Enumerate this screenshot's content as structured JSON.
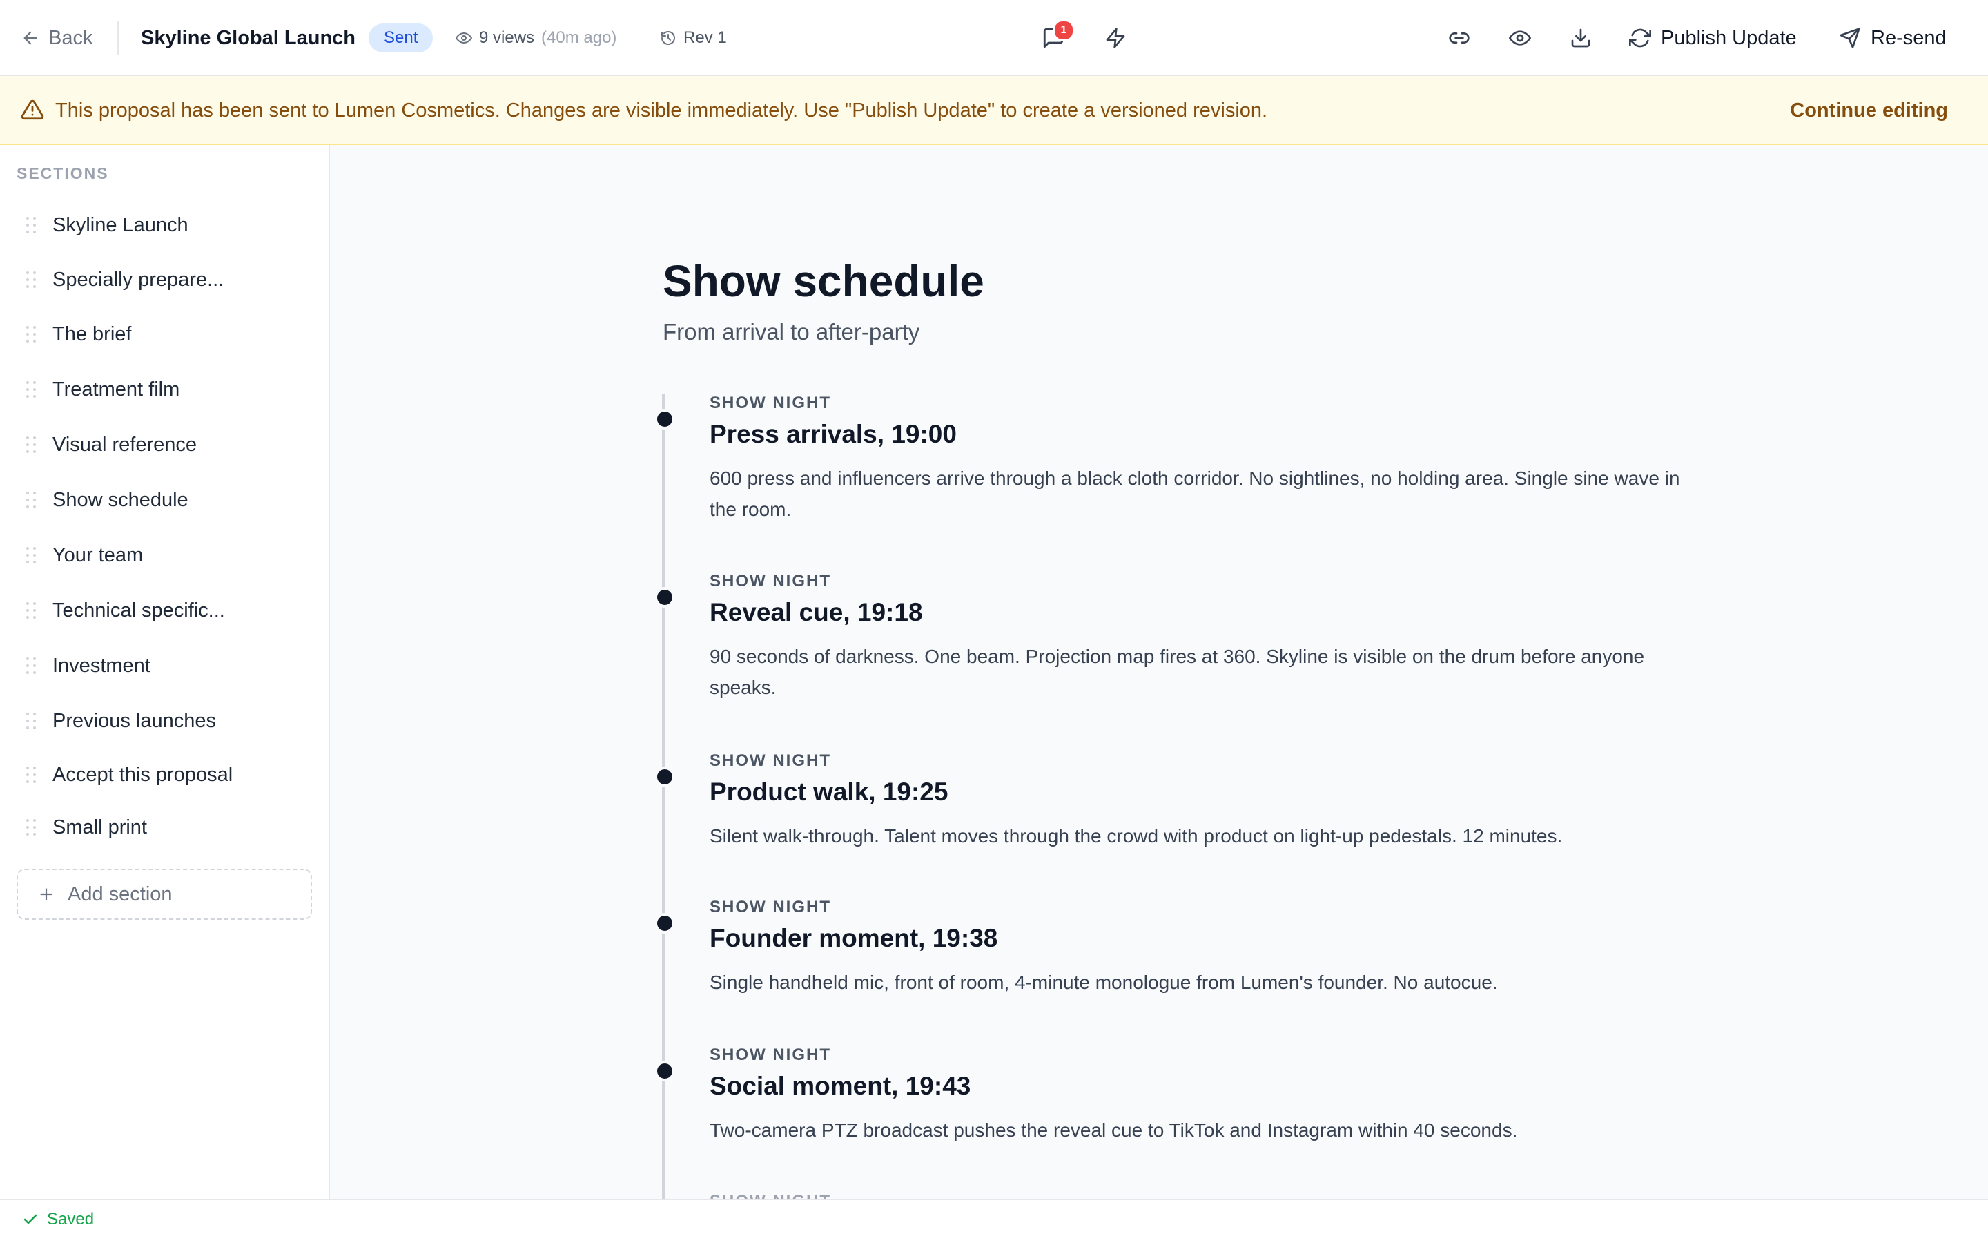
{
  "header": {
    "back_label": "Back",
    "title": "Skyline Global Launch",
    "status_badge": "Sent",
    "views_count": "9 views",
    "views_time": "(40m ago)",
    "revision": "Rev 1",
    "notification_count": "1",
    "publish_label": "Publish Update",
    "resend_label": "Re-send"
  },
  "banner": {
    "message": "This proposal has been sent to Lumen Cosmetics. Changes are visible immediately. Use \"Publish Update\" to create a versioned revision.",
    "action_label": "Continue editing"
  },
  "sidebar": {
    "heading": "SECTIONS",
    "items": [
      {
        "label": "Skyline Launch"
      },
      {
        "label": "Specially prepare..."
      },
      {
        "label": "The brief"
      },
      {
        "label": "Treatment film"
      },
      {
        "label": "Visual reference"
      },
      {
        "label": "Show schedule"
      },
      {
        "label": "Your team"
      },
      {
        "label": "Technical specific..."
      },
      {
        "label": "Investment"
      },
      {
        "label": "Previous launches"
      },
      {
        "label": "Accept this proposal"
      },
      {
        "label": "Small print"
      }
    ],
    "add_label": "Add section"
  },
  "main": {
    "title": "Show schedule",
    "subtitle": "From arrival to after-party",
    "events": [
      {
        "kicker": "SHOW NIGHT",
        "title": "Press arrivals, 19:00",
        "description": "600 press and influencers arrive through a black cloth corridor. No sightlines, no holding area. Single sine wave in the room."
      },
      {
        "kicker": "SHOW NIGHT",
        "title": "Reveal cue, 19:18",
        "description": "90 seconds of darkness. One beam. Projection map fires at 360. Skyline is visible on the drum before anyone speaks."
      },
      {
        "kicker": "SHOW NIGHT",
        "title": "Product walk, 19:25",
        "description": "Silent walk-through. Talent moves through the crowd with product on light-up pedestals. 12 minutes."
      },
      {
        "kicker": "SHOW NIGHT",
        "title": "Founder moment, 19:38",
        "description": "Single handheld mic, front of room, 4-minute monologue from Lumen's founder. No autocue."
      },
      {
        "kicker": "SHOW NIGHT",
        "title": "Social moment, 19:43",
        "description": "Two-camera PTZ broadcast pushes the reveal cue to TikTok and Instagram within 40 seconds."
      }
    ],
    "next_kicker": "SHOW NIGHT"
  },
  "footer": {
    "status": "Saved"
  },
  "colors": {
    "banner_bg": "#fefce8",
    "banner_text": "#854d0e",
    "badge_bg": "#dbeafe",
    "badge_text": "#1d4ed8",
    "notification": "#ef4444",
    "saved": "#16a34a"
  }
}
